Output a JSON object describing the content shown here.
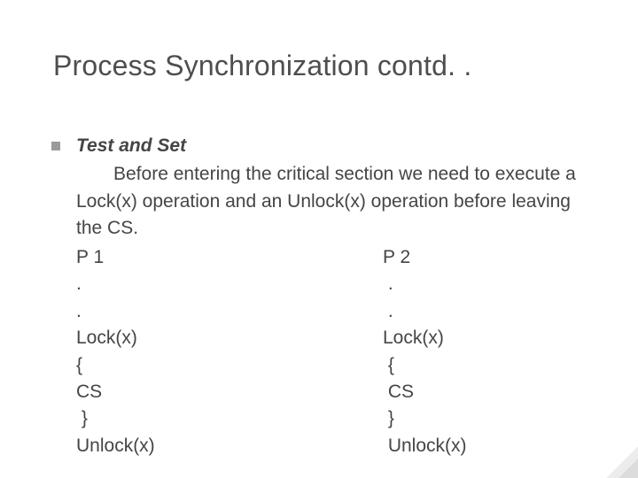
{
  "title": "Process Synchronization contd. .",
  "subhead": "Test and Set",
  "description_html": "Before entering the critical section we need to execute a Lock(x) operation and an Unlock(x) operation before leaving the CS.",
  "columns": {
    "left": {
      "header": "P 1",
      "lines": [
        ".",
        ".",
        "Lock(x)",
        "{",
        "CS",
        " }",
        "Unlock(x)"
      ]
    },
    "right": {
      "header": "P 2",
      "lines": [
        " .",
        " .",
        "Lock(x)",
        " {",
        " CS",
        " }",
        " Unlock(x)"
      ]
    }
  }
}
